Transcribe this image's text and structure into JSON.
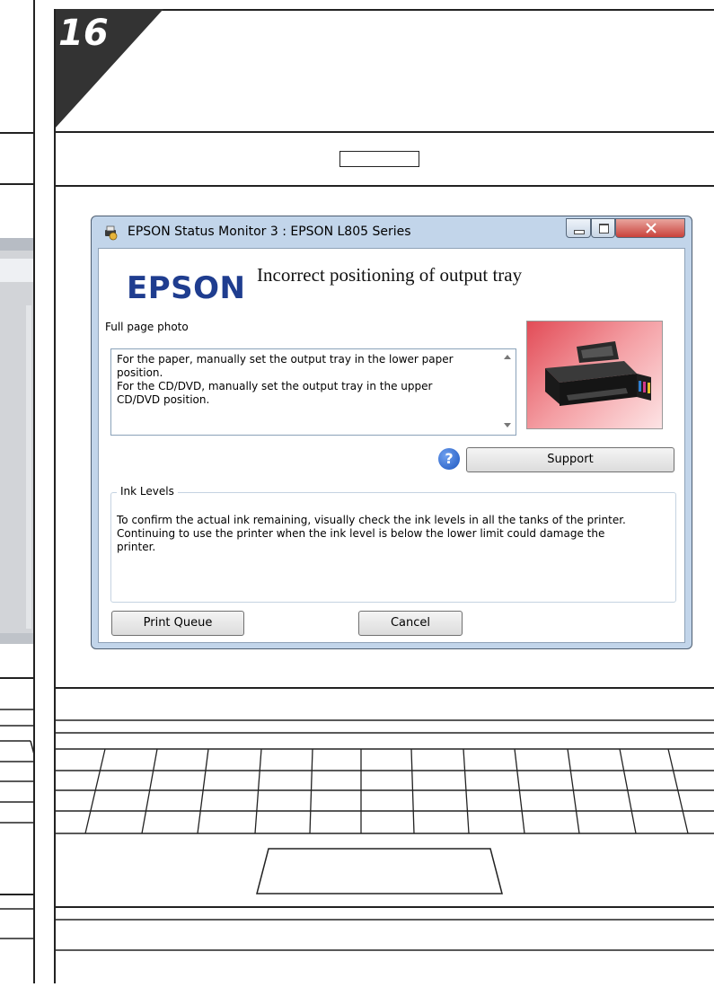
{
  "step_number": "16",
  "window": {
    "title": "EPSON Status Monitor 3 : EPSON L805 Series",
    "logo_text": "EPSON",
    "message_title": "Incorrect positioning of output tray",
    "media_type": "Full page photo",
    "message_lines": [
      "For the paper, manually set the output tray in the lower paper",
      "position.",
      "For the CD/DVD, manually set the output tray in the upper",
      "CD/DVD position."
    ],
    "help_icon_glyph": "?",
    "support_label": "Support",
    "ink_group_label": "Ink Levels",
    "ink_lines": [
      "To confirm the actual ink remaining, visually check the ink levels in all the tanks of the printer.",
      "Continuing to use the printer when the ink level is below the lower limit could damage the",
      "printer."
    ],
    "print_queue_label": "Print Queue",
    "cancel_label": "Cancel"
  },
  "icons": {
    "app": "printer-status-icon",
    "minimize": "minimize-icon",
    "maximize": "maximize-icon",
    "close": "close-icon",
    "help": "help-icon",
    "printer_photo": "printer-image"
  },
  "colors": {
    "logo": "#1f3d8f",
    "close_button": "#c9423b",
    "frame": "#c2d5ea",
    "help": "#1c56bf"
  }
}
